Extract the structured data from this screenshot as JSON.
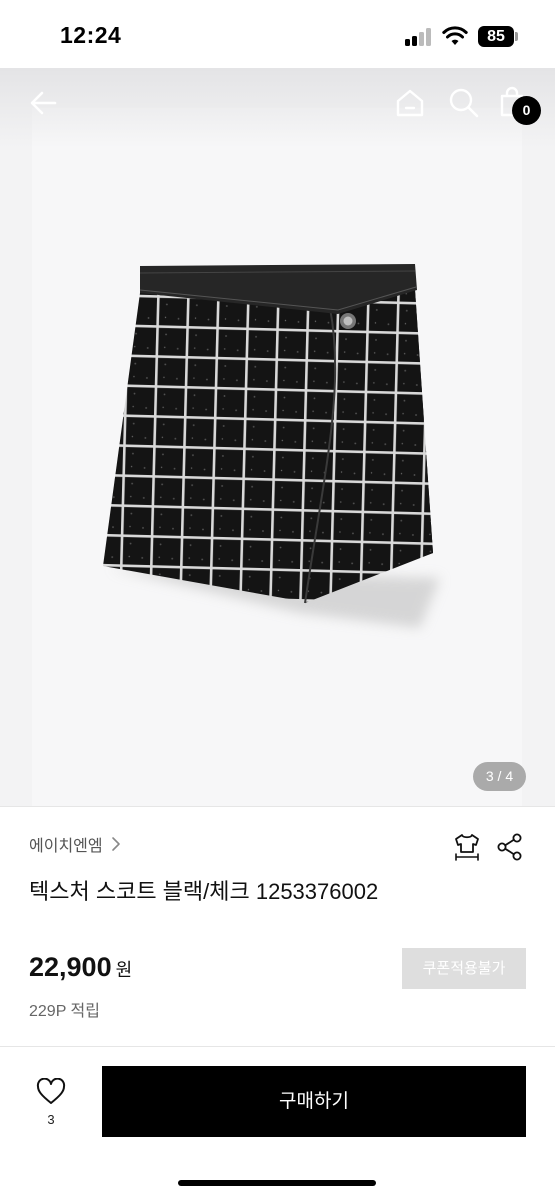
{
  "status_bar": {
    "time": "12:24",
    "battery": "85",
    "icons": [
      "cellular-signal-icon",
      "wifi-icon",
      "battery-icon"
    ]
  },
  "nav": {
    "icons": [
      "back-arrow-icon",
      "home-icon",
      "search-icon",
      "shopping-bag-icon"
    ],
    "cart_count": "0"
  },
  "gallery": {
    "indicator": "3 / 4",
    "image": "black-white-check-tweed-skort"
  },
  "product": {
    "brand": "에이치엔엠",
    "title": "텍스처 스코트 블랙/체크 1253376002",
    "price": "22,900",
    "price_unit": "원",
    "points": "229P 적립",
    "coupon_label": "쿠폰적용불가",
    "icons": [
      "size-guide-shirt-icon",
      "share-icon"
    ]
  },
  "footer": {
    "like_count": "3",
    "buy_label": "구매하기"
  },
  "colors": {
    "primary": "#000000",
    "disabled_button": "#dedede",
    "muted_text": "#666666"
  }
}
